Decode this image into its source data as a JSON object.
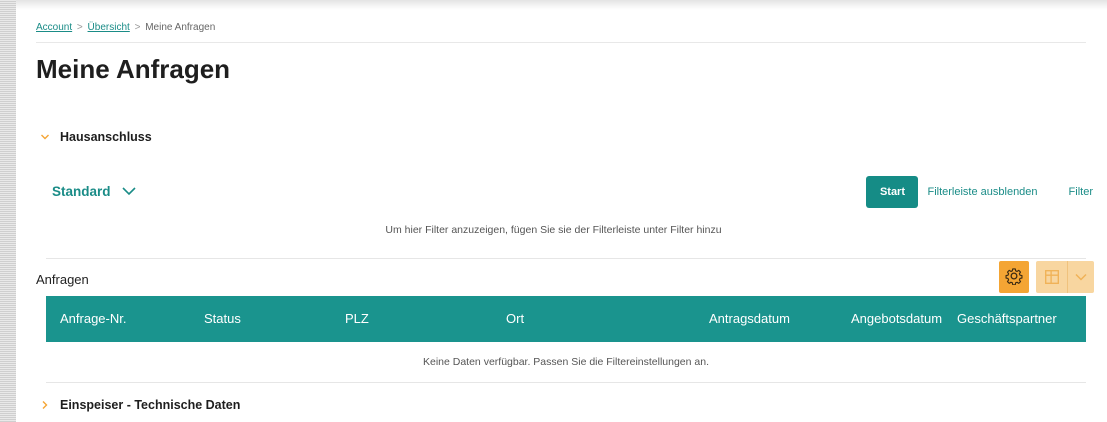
{
  "breadcrumb": {
    "items": [
      "Account",
      "Übersicht"
    ],
    "separator": ">",
    "current": "Meine Anfragen"
  },
  "page": {
    "title": "Meine Anfragen"
  },
  "sections": {
    "hausanschluss": {
      "label": "Hausanschluss",
      "expanded": true
    },
    "einspeiser": {
      "label": "Einspeiser - Technische Daten",
      "expanded": false
    }
  },
  "filterbar": {
    "variant_label": "Standard",
    "start_label": "Start",
    "hide_label": "Filterleiste ausblenden",
    "filter_label": "Filter",
    "hint": "Um hier Filter anzuzeigen, fügen Sie sie der Filterleiste unter Filter hinzu"
  },
  "table": {
    "title": "Anfragen",
    "columns": [
      "Anfrage-Nr.",
      "Status",
      "PLZ",
      "Ort",
      "Antragsdatum",
      "Angebotsdatum",
      "Geschäftspartner"
    ],
    "empty_text": "Keine Daten verfügbar. Passen Sie die Filtereinstellungen an."
  },
  "icons": {
    "settings": "gear-icon",
    "export": "spreadsheet-export-icon",
    "dropdown": "chevron-down-icon",
    "expand": "chevron-right-icon",
    "collapse": "chevron-down-icon"
  },
  "colors": {
    "accent": "#1a8c87",
    "table_header": "#1a948e",
    "orange": "#f4a534",
    "orange_light": "#f8d6a0"
  }
}
